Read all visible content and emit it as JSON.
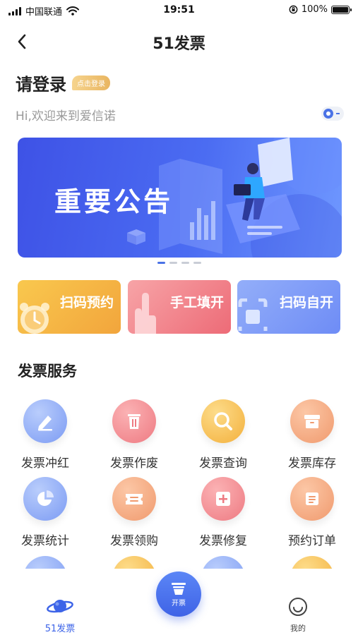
{
  "status_bar": {
    "carrier": "中国联通",
    "time": "19:51",
    "battery": "100%",
    "battery_level": 1.0
  },
  "nav": {
    "title": "51发票",
    "back_icon": "chevron-left-icon"
  },
  "login": {
    "title": "请登录",
    "badge": "点击登录",
    "welcome": "Hi,欢迎来到爱信诺"
  },
  "banner": {
    "title": "重要公告",
    "page_count": 4,
    "active_page": 1
  },
  "quick_actions": [
    {
      "label": "扫码预约",
      "icon": "alarm-clock-icon"
    },
    {
      "label": "手工填开",
      "icon": "hand-pointer-icon"
    },
    {
      "label": "扫码自开",
      "icon": "scan-frame-icon"
    }
  ],
  "services": {
    "title": "发票服务",
    "items": [
      {
        "label": "发票冲红",
        "icon": "pencil-icon",
        "color": "#7c9bf3"
      },
      {
        "label": "发票作废",
        "icon": "trash-icon",
        "color": "#ee7a82"
      },
      {
        "label": "发票查询",
        "icon": "search-icon",
        "color": "#f3b03c"
      },
      {
        "label": "发票库存",
        "icon": "storage-box-icon",
        "color": "#f09a6e"
      },
      {
        "label": "发票统计",
        "icon": "pie-chart-icon",
        "color": "#7c9bf3"
      },
      {
        "label": "发票领购",
        "icon": "ticket-icon",
        "color": "#f09a6e"
      },
      {
        "label": "发票修复",
        "icon": "plus-box-icon",
        "color": "#ee7a82"
      },
      {
        "label": "预约订单",
        "icon": "order-list-icon",
        "color": "#f09a6e"
      }
    ]
  },
  "tabbar": {
    "home_label": "51发票",
    "center_label": "开票",
    "mine_label": "我的",
    "accent": "#3d64e8"
  }
}
